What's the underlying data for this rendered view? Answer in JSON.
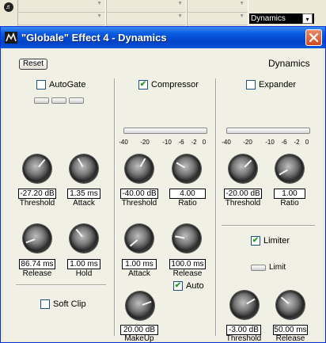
{
  "background": {
    "dropdown_value": "Dynamics"
  },
  "window": {
    "title": "\"Globale\" Effect 4 - Dynamics",
    "close_glyph": "✕"
  },
  "header": {
    "reset_label": "Reset",
    "section_title": "Dynamics"
  },
  "autogate": {
    "label": "AutoGate",
    "checked": false,
    "threshold": {
      "value": "-27.20 dB",
      "label": "Threshold"
    },
    "attack": {
      "value": "1.35 ms",
      "label": "Attack"
    },
    "release": {
      "value": "86.74 ms",
      "label": "Release"
    },
    "hold": {
      "value": "1.00 ms",
      "label": "Hold"
    }
  },
  "soft_clip": {
    "label": "Soft Clip",
    "checked": false
  },
  "compressor": {
    "label": "Compressor",
    "checked": true,
    "threshold": {
      "value": "-40.00 dB",
      "label": "Threshold"
    },
    "ratio": {
      "value": "4.00",
      "label": "Ratio"
    },
    "attack": {
      "value": "1.00 ms",
      "label": "Attack"
    },
    "release": {
      "value": "100.0 ms",
      "label": "Release"
    },
    "auto": {
      "label": "Auto",
      "checked": true
    },
    "makeup": {
      "value": "20.00 dB",
      "label": "MakeUp"
    }
  },
  "expander": {
    "label": "Expander",
    "checked": false,
    "threshold": {
      "value": "-20.00 dB",
      "label": "Threshold"
    },
    "ratio": {
      "value": "1.00",
      "label": "Ratio"
    }
  },
  "limiter": {
    "label": "Limiter",
    "checked": true,
    "limit_label": "Limit",
    "threshold": {
      "value": "-3.00 dB",
      "label": "Threshold"
    },
    "release": {
      "value": "50.00 ms",
      "label": "Release"
    }
  },
  "meter_scale": [
    "-40",
    "-20",
    "-10",
    "-6",
    "-2",
    "0"
  ],
  "icons": {
    "check": "✔",
    "dropdown": "▾",
    "close": "x-close-icon",
    "app": "app-icon"
  },
  "colors": {
    "title_bar": "#0a5be0",
    "close_button": "#d24a1e",
    "check_mark": "#21a121"
  }
}
